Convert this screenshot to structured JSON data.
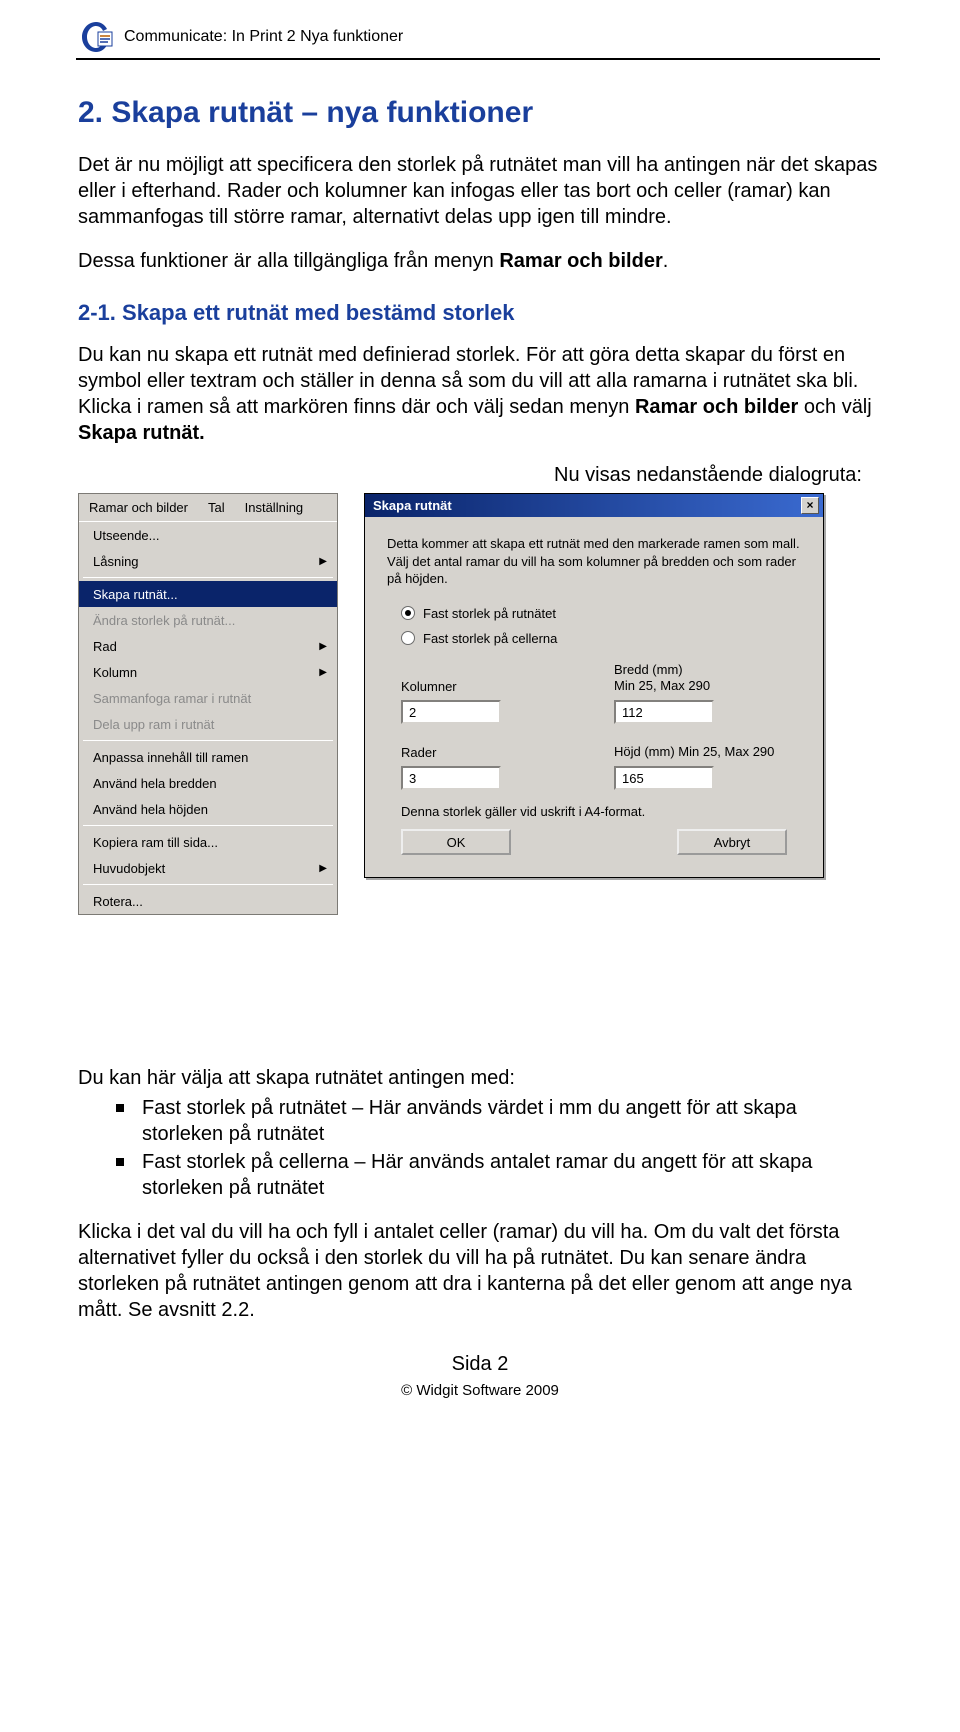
{
  "header": {
    "title": "Communicate: In Print 2 Nya funktioner"
  },
  "h1": "2. Skapa rutnät – nya funktioner",
  "intro_p1": "Det är nu möjligt att specificera den storlek på rutnätet man vill ha antingen när det skapas eller i efterhand. Rader och kolumner kan infogas eller tas bort och celler (ramar) kan sammanfogas till större ramar, alternativt delas upp igen till mindre.",
  "intro_p2_a": "Dessa funktioner är alla tillgängliga från menyn ",
  "intro_p2_b": "Ramar och bilder",
  "intro_p2_c": ".",
  "h2": "2-1. Skapa ett rutnät med bestämd storlek",
  "p21_a": "Du kan nu skapa ett rutnät med definierad storlek. För att göra detta skapar du först en symbol eller textram och ställer in denna så som du vill att alla ramarna i rutnätet ska bli. Klicka i ramen så att markören finns där och välj sedan menyn ",
  "p21_b": "Ramar och bilder",
  "p21_c": " och välj  ",
  "p21_d": "Skapa rutnät.",
  "dialog_caption": "Nu visas nedanstående dialogruta:",
  "menu_bar": [
    "Ramar och bilder",
    "Tal",
    "Inställning"
  ],
  "menu_items": [
    {
      "label": "Utseende...",
      "arrow": false,
      "disabled": false,
      "highlight": false
    },
    {
      "label": "Låsning",
      "arrow": true,
      "disabled": false,
      "highlight": false
    },
    {
      "sep": true
    },
    {
      "label": "Skapa rutnät...",
      "arrow": false,
      "disabled": false,
      "highlight": true
    },
    {
      "label": "Ändra storlek på rutnät...",
      "arrow": false,
      "disabled": true,
      "highlight": false
    },
    {
      "label": "Rad",
      "arrow": true,
      "disabled": false,
      "highlight": false
    },
    {
      "label": "Kolumn",
      "arrow": true,
      "disabled": false,
      "highlight": false
    },
    {
      "label": "Sammanfoga ramar i rutnät",
      "arrow": false,
      "disabled": true,
      "highlight": false
    },
    {
      "label": "Dela upp ram i rutnät",
      "arrow": false,
      "disabled": true,
      "highlight": false
    },
    {
      "sep": true
    },
    {
      "label": "Anpassa innehåll till ramen",
      "arrow": false,
      "disabled": false,
      "highlight": false
    },
    {
      "label": "Använd hela bredden",
      "arrow": false,
      "disabled": false,
      "highlight": false
    },
    {
      "label": "Använd hela höjden",
      "arrow": false,
      "disabled": false,
      "highlight": false
    },
    {
      "sep": true
    },
    {
      "label": "Kopiera ram till sida...",
      "arrow": false,
      "disabled": false,
      "highlight": false
    },
    {
      "label": "Huvudobjekt",
      "arrow": true,
      "disabled": false,
      "highlight": false
    },
    {
      "sep": true
    },
    {
      "label": "Rotera...",
      "arrow": false,
      "disabled": false,
      "highlight": false
    }
  ],
  "dialog": {
    "title": "Skapa rutnät",
    "intro": "Detta kommer att skapa ett rutnät med den markerade ramen som mall. Välj det antal ramar du vill ha som  kolumner på bredden och som rader på höjden.",
    "radio1": "Fast storlek på rutnätet",
    "radio2": "Fast storlek på cellerna",
    "kolumner_label": "Kolumner",
    "bredd_label": "Bredd (mm)\nMin 25, Max 290",
    "rader_label": "Rader",
    "hojd_label": "Höjd (mm)   Min 25, Max 290",
    "kolumner_value": "2",
    "bredd_value": "112",
    "rader_value": "3",
    "hojd_value": "165",
    "note": "Denna storlek gäller vid uskrift i A4-format.",
    "ok": "OK",
    "cancel": "Avbryt"
  },
  "list_intro": "Du kan här välja att skapa rutnätet antingen med:",
  "list": [
    "Fast storlek på rutnätet – Här används värdet i mm du angett för att skapa storleken på rutnätet",
    "Fast storlek på cellerna – Här används antalet ramar du angett för att skapa storleken på rutnätet"
  ],
  "p_out": "Klicka i det val du vill ha och fyll i antalet celler (ramar) du vill ha. Om du valt det första alternativet fyller du också i den storlek du vill ha på rutnätet. Du kan senare ändra storleken på rutnätet antingen genom att dra i kanterna på det eller genom att ange nya mått. Se avsnitt 2.2.",
  "footer": {
    "page": "Sida 2",
    "copyright": "© Widgit Software 2009"
  }
}
